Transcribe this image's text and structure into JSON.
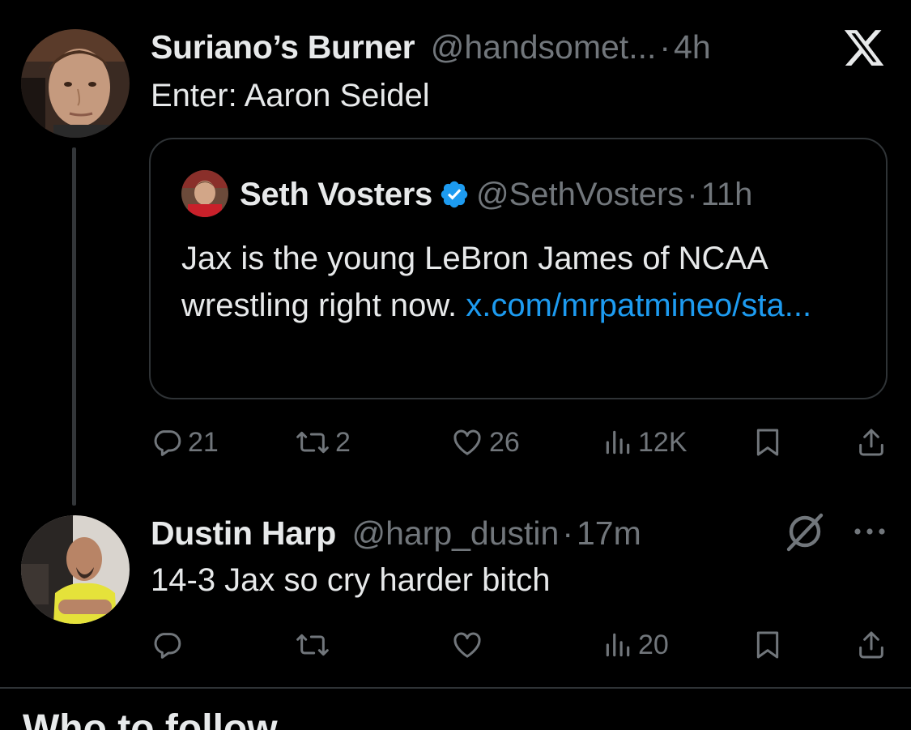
{
  "tweet1": {
    "display_name": "Suriano’s Burner",
    "handle": "@handsomet...",
    "dot": "·",
    "time": "4h",
    "text": "Enter: Aaron Seidel",
    "quote": {
      "display_name": "Seth Vosters",
      "handle": "@SethVosters",
      "dot": "·",
      "time": "11h",
      "text": "Jax is the young LeBron James of NCAA wrestling right now.",
      "link": "x.com/mrpatmineo/sta..."
    },
    "actions": {
      "replies": "21",
      "reposts": "2",
      "likes": "26",
      "views": "12K"
    }
  },
  "tweet2": {
    "display_name": "Dustin Harp",
    "handle": "@harp_dustin",
    "dot": "·",
    "time": "17m",
    "text": "14-3 Jax so cry harder bitch",
    "actions": {
      "views": "20"
    }
  },
  "section_heading": "Who to follow",
  "colors": {
    "background": "#000000",
    "text": "#e7e9ea",
    "muted": "#71767b",
    "link": "#1d9bf0",
    "border": "#2f3336"
  },
  "icons": [
    "x-logo-icon",
    "verified-badge-icon",
    "reply-icon",
    "repost-icon",
    "like-icon",
    "views-icon",
    "bookmark-icon",
    "share-icon",
    "grok-icon",
    "more-icon"
  ]
}
